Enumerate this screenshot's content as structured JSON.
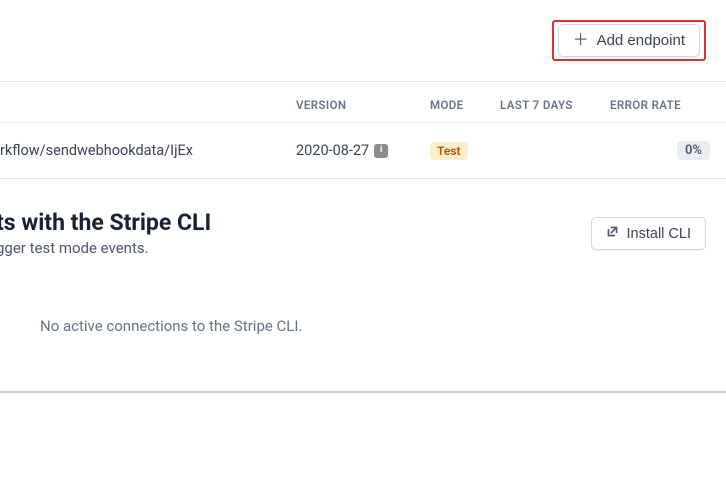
{
  "header": {
    "addEndpointLabel": "Add endpoint"
  },
  "table": {
    "columns": {
      "version": "VERSION",
      "mode": "MODE",
      "last7days": "LAST 7 DAYS",
      "errorRate": "ERROR RATE"
    },
    "rows": [
      {
        "url": "rkflow/sendwebhookdata/IjEx",
        "version": "2020-08-27",
        "mode": "Test",
        "last7days": "",
        "errorRate": "0%"
      }
    ]
  },
  "cli": {
    "title": "ts with the Stripe CLI",
    "subtitle": "gger test mode events.",
    "installLabel": "Install CLI",
    "noConnections": "No active connections to the Stripe CLI."
  },
  "icons": {
    "info": "i"
  }
}
